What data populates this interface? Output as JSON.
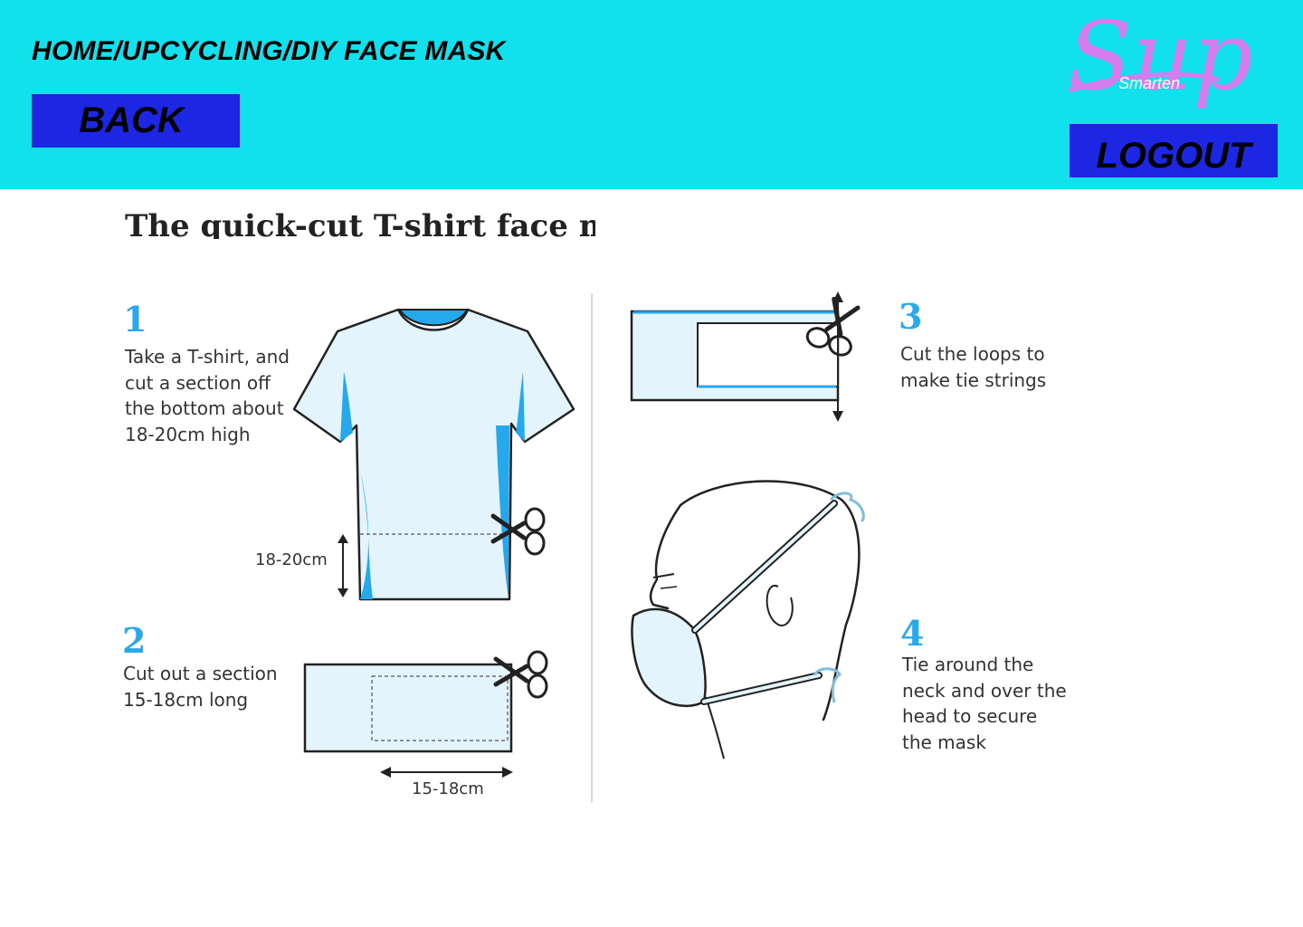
{
  "header": {
    "breadcrumb": "HOME/UPCYCLING/DIY FACE MASK",
    "back_label": "BACK",
    "logout_label": "LOGOUT",
    "logo": {
      "script_text": "Sup",
      "sub_text": "Smarten",
      "color": "#d77bf0"
    },
    "background_color": "#13e0ed",
    "button_color": "#1d26e3"
  },
  "guide": {
    "title": "The quick-cut T-shirt face mask",
    "accent_color": "#2aa8ec",
    "steps": [
      {
        "number": "1",
        "text": "Take a T-shirt, and\ncut a section off\nthe bottom about\n18-20cm high"
      },
      {
        "number": "2",
        "text": "Cut out a section\n15-18cm long"
      },
      {
        "number": "3",
        "text": "Cut the loops to\nmake tie strings"
      },
      {
        "number": "4",
        "text": "Tie around the\nneck and over the\nhead to secure\nthe mask"
      }
    ],
    "dimensions": {
      "height": "18-20cm",
      "length": "15-18cm"
    }
  }
}
